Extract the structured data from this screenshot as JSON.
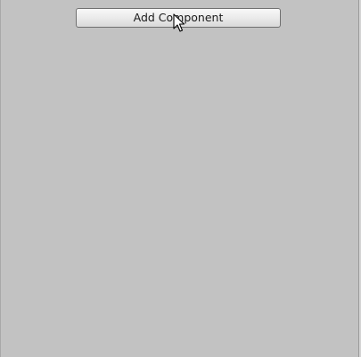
{
  "inspector": {
    "add_component_label": "Add Component"
  },
  "pointer": {
    "icon": "arrow-cursor-icon"
  },
  "colors": {
    "panel_background": "#c2c2c2",
    "button_border": "#707070"
  }
}
